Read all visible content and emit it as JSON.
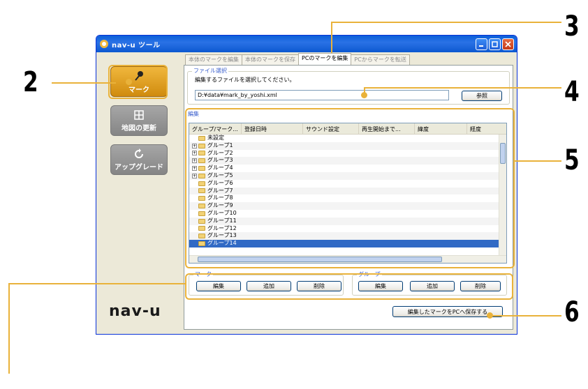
{
  "window": {
    "title": "nav-u ツール"
  },
  "sidebar": {
    "items": [
      {
        "label": "マーク"
      },
      {
        "label": "地図の更新"
      },
      {
        "label": "アップグレード"
      }
    ],
    "logo": "nav-u"
  },
  "tabs": [
    {
      "label": "本体のマークを編集"
    },
    {
      "label": "本体のマークを保存"
    },
    {
      "label": "PCのマークを編集"
    },
    {
      "label": "PCからマークを転送"
    }
  ],
  "file_select": {
    "group_label": "ファイル選択",
    "instruction": "編集するファイルを選択してください。",
    "path": "D:¥data¥mark_by_yoshi.xml",
    "browse_label": "参照"
  },
  "edit_group_label": "編集",
  "table": {
    "columns": [
      "グループ/マーク...",
      "登録日時",
      "サウンド設定",
      "再生開始まで...",
      "緯度",
      "経度"
    ],
    "rows": [
      {
        "label": "未設定",
        "expandable": false
      },
      {
        "label": "グループ1",
        "expandable": true
      },
      {
        "label": "グループ2",
        "expandable": true
      },
      {
        "label": "グループ3",
        "expandable": true
      },
      {
        "label": "グループ4",
        "expandable": true
      },
      {
        "label": "グループ5",
        "expandable": true
      },
      {
        "label": "グループ6",
        "expandable": false
      },
      {
        "label": "グループ7",
        "expandable": false
      },
      {
        "label": "グループ8",
        "expandable": false
      },
      {
        "label": "グループ9",
        "expandable": false
      },
      {
        "label": "グループ10",
        "expandable": false
      },
      {
        "label": "グループ11",
        "expandable": false
      },
      {
        "label": "グループ12",
        "expandable": false
      },
      {
        "label": "グループ13",
        "expandable": false
      },
      {
        "label": "グループ14",
        "expandable": false,
        "selected": true
      }
    ]
  },
  "mark_group": {
    "label": "マーク",
    "edit": "編集",
    "add": "追加",
    "delete": "削除"
  },
  "group_group": {
    "label": "グループ",
    "edit": "編集",
    "add": "追加",
    "delete": "削除"
  },
  "save_button": "編集したマークをPCへ保存する",
  "callouts": [
    "2",
    "3",
    "4",
    "5",
    "6"
  ],
  "colors": {
    "accent": "#e9b23a",
    "titlebar": "#0a5fd8",
    "selection": "#316ac5"
  }
}
